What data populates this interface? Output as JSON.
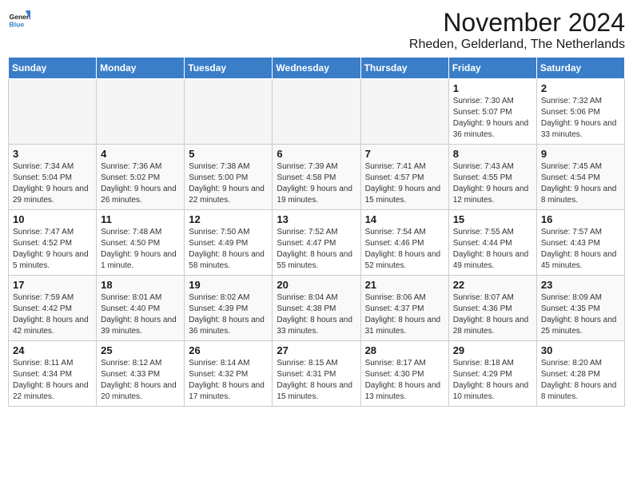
{
  "logo": {
    "line1": "General",
    "line2": "Blue"
  },
  "title": "November 2024",
  "subtitle": "Rheden, Gelderland, The Netherlands",
  "days_of_week": [
    "Sunday",
    "Monday",
    "Tuesday",
    "Wednesday",
    "Thursday",
    "Friday",
    "Saturday"
  ],
  "weeks": [
    [
      {
        "day": "",
        "info": ""
      },
      {
        "day": "",
        "info": ""
      },
      {
        "day": "",
        "info": ""
      },
      {
        "day": "",
        "info": ""
      },
      {
        "day": "",
        "info": ""
      },
      {
        "day": "1",
        "info": "Sunrise: 7:30 AM\nSunset: 5:07 PM\nDaylight: 9 hours and 36 minutes."
      },
      {
        "day": "2",
        "info": "Sunrise: 7:32 AM\nSunset: 5:06 PM\nDaylight: 9 hours and 33 minutes."
      }
    ],
    [
      {
        "day": "3",
        "info": "Sunrise: 7:34 AM\nSunset: 5:04 PM\nDaylight: 9 hours and 29 minutes."
      },
      {
        "day": "4",
        "info": "Sunrise: 7:36 AM\nSunset: 5:02 PM\nDaylight: 9 hours and 26 minutes."
      },
      {
        "day": "5",
        "info": "Sunrise: 7:38 AM\nSunset: 5:00 PM\nDaylight: 9 hours and 22 minutes."
      },
      {
        "day": "6",
        "info": "Sunrise: 7:39 AM\nSunset: 4:58 PM\nDaylight: 9 hours and 19 minutes."
      },
      {
        "day": "7",
        "info": "Sunrise: 7:41 AM\nSunset: 4:57 PM\nDaylight: 9 hours and 15 minutes."
      },
      {
        "day": "8",
        "info": "Sunrise: 7:43 AM\nSunset: 4:55 PM\nDaylight: 9 hours and 12 minutes."
      },
      {
        "day": "9",
        "info": "Sunrise: 7:45 AM\nSunset: 4:54 PM\nDaylight: 9 hours and 8 minutes."
      }
    ],
    [
      {
        "day": "10",
        "info": "Sunrise: 7:47 AM\nSunset: 4:52 PM\nDaylight: 9 hours and 5 minutes."
      },
      {
        "day": "11",
        "info": "Sunrise: 7:48 AM\nSunset: 4:50 PM\nDaylight: 9 hours and 1 minute."
      },
      {
        "day": "12",
        "info": "Sunrise: 7:50 AM\nSunset: 4:49 PM\nDaylight: 8 hours and 58 minutes."
      },
      {
        "day": "13",
        "info": "Sunrise: 7:52 AM\nSunset: 4:47 PM\nDaylight: 8 hours and 55 minutes."
      },
      {
        "day": "14",
        "info": "Sunrise: 7:54 AM\nSunset: 4:46 PM\nDaylight: 8 hours and 52 minutes."
      },
      {
        "day": "15",
        "info": "Sunrise: 7:55 AM\nSunset: 4:44 PM\nDaylight: 8 hours and 49 minutes."
      },
      {
        "day": "16",
        "info": "Sunrise: 7:57 AM\nSunset: 4:43 PM\nDaylight: 8 hours and 45 minutes."
      }
    ],
    [
      {
        "day": "17",
        "info": "Sunrise: 7:59 AM\nSunset: 4:42 PM\nDaylight: 8 hours and 42 minutes."
      },
      {
        "day": "18",
        "info": "Sunrise: 8:01 AM\nSunset: 4:40 PM\nDaylight: 8 hours and 39 minutes."
      },
      {
        "day": "19",
        "info": "Sunrise: 8:02 AM\nSunset: 4:39 PM\nDaylight: 8 hours and 36 minutes."
      },
      {
        "day": "20",
        "info": "Sunrise: 8:04 AM\nSunset: 4:38 PM\nDaylight: 8 hours and 33 minutes."
      },
      {
        "day": "21",
        "info": "Sunrise: 8:06 AM\nSunset: 4:37 PM\nDaylight: 8 hours and 31 minutes."
      },
      {
        "day": "22",
        "info": "Sunrise: 8:07 AM\nSunset: 4:36 PM\nDaylight: 8 hours and 28 minutes."
      },
      {
        "day": "23",
        "info": "Sunrise: 8:09 AM\nSunset: 4:35 PM\nDaylight: 8 hours and 25 minutes."
      }
    ],
    [
      {
        "day": "24",
        "info": "Sunrise: 8:11 AM\nSunset: 4:34 PM\nDaylight: 8 hours and 22 minutes."
      },
      {
        "day": "25",
        "info": "Sunrise: 8:12 AM\nSunset: 4:33 PM\nDaylight: 8 hours and 20 minutes."
      },
      {
        "day": "26",
        "info": "Sunrise: 8:14 AM\nSunset: 4:32 PM\nDaylight: 8 hours and 17 minutes."
      },
      {
        "day": "27",
        "info": "Sunrise: 8:15 AM\nSunset: 4:31 PM\nDaylight: 8 hours and 15 minutes."
      },
      {
        "day": "28",
        "info": "Sunrise: 8:17 AM\nSunset: 4:30 PM\nDaylight: 8 hours and 13 minutes."
      },
      {
        "day": "29",
        "info": "Sunrise: 8:18 AM\nSunset: 4:29 PM\nDaylight: 8 hours and 10 minutes."
      },
      {
        "day": "30",
        "info": "Sunrise: 8:20 AM\nSunset: 4:28 PM\nDaylight: 8 hours and 8 minutes."
      }
    ]
  ]
}
